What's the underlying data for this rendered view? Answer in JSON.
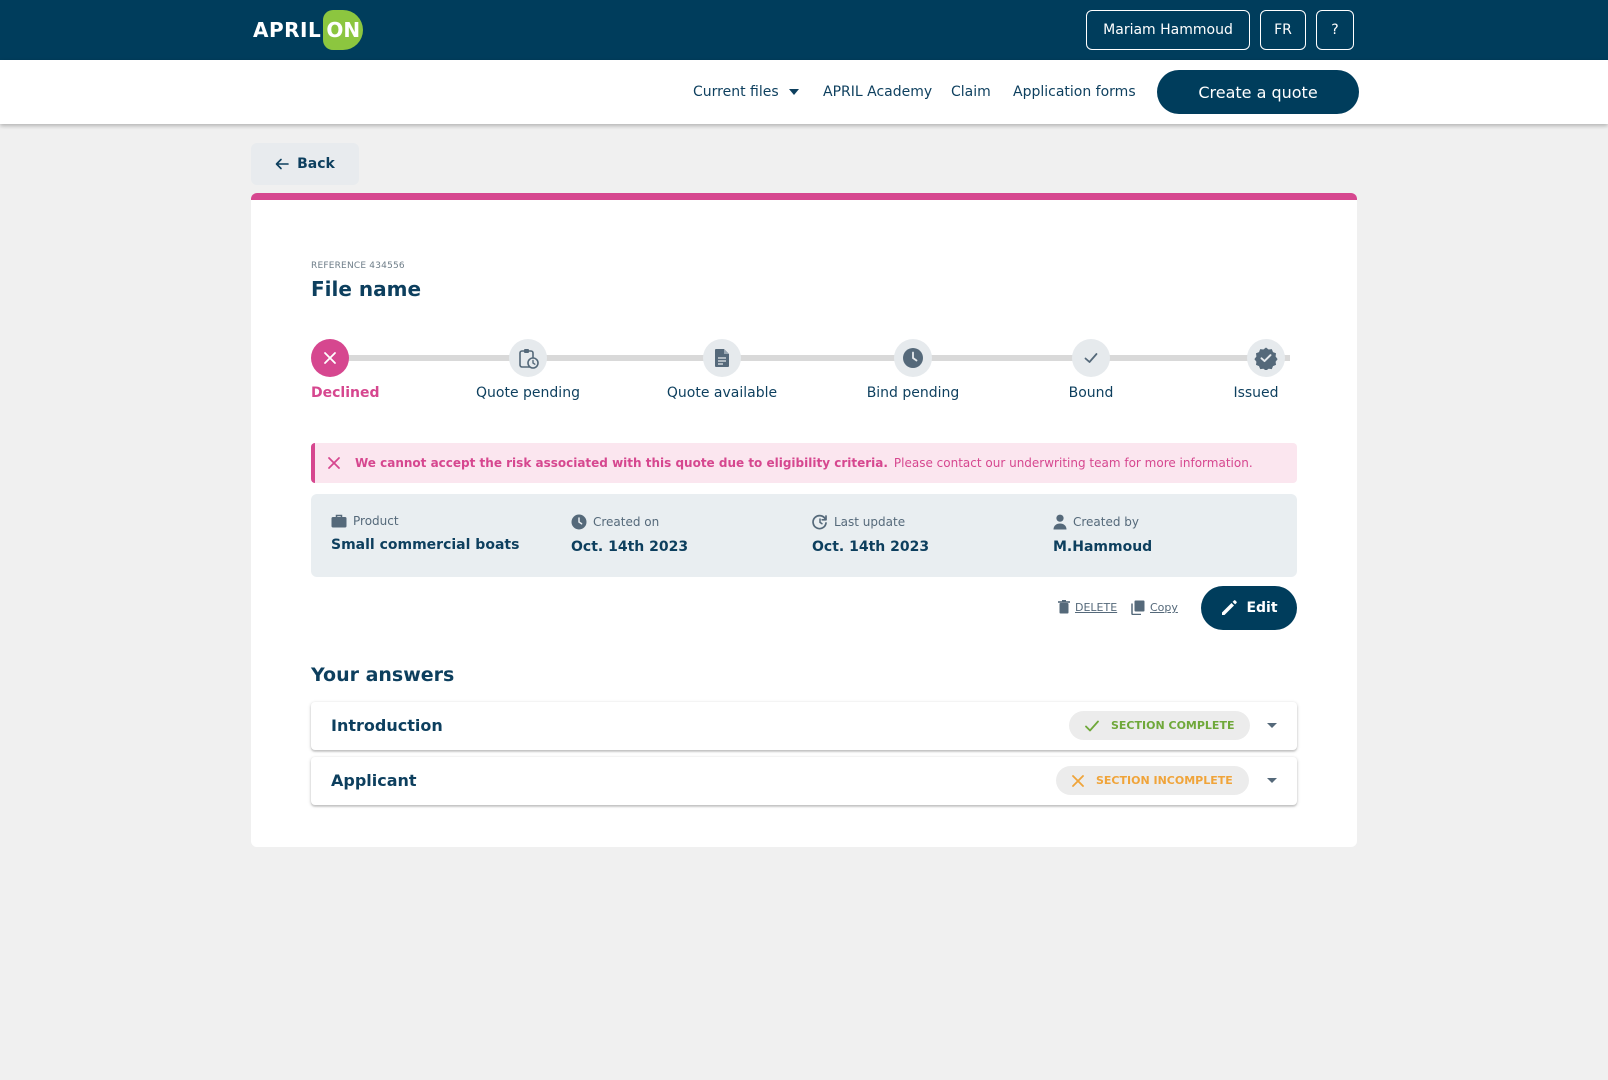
{
  "header": {
    "logo_text": "APRIL",
    "logo_badge": "ON",
    "user_button": "Mariam Hammoud",
    "lang_button": "FR",
    "help_button": "?"
  },
  "nav": {
    "current_files": "Current files",
    "academy": "APRIL Academy",
    "claim": "Claim",
    "application_forms": "Application forms",
    "create_quote": "Create a quote"
  },
  "back_label": "Back",
  "file": {
    "reference": "REFERENCE 434556",
    "name": "File name"
  },
  "steps": [
    {
      "label": "Declined",
      "icon": "close-icon",
      "state": "active"
    },
    {
      "label": "Quote pending",
      "icon": "clipboard-clock-icon",
      "state": "inactive"
    },
    {
      "label": "Quote available",
      "icon": "document-icon",
      "state": "inactive"
    },
    {
      "label": "Bind pending",
      "icon": "clock-icon",
      "state": "inactive"
    },
    {
      "label": "Bound",
      "icon": "check-icon",
      "state": "inactive"
    },
    {
      "label": "Issued",
      "icon": "verified-badge-icon",
      "state": "inactive"
    }
  ],
  "alert": {
    "bold": "We cannot accept the risk associated with this quote due to eligibility criteria.",
    "text": "Please contact our underwriting team for more information."
  },
  "info": {
    "product_label": "Product",
    "product_value": "Small commercial boats",
    "created_on_label": "Created on",
    "created_on_value": "Oct. 14th 2023",
    "last_update_label": "Last update",
    "last_update_value": "Oct. 14th 2023",
    "created_by_label": "Created by",
    "created_by_value": "M.Hammoud"
  },
  "actions": {
    "delete": "DELETE",
    "copy": "Copy",
    "edit": "Edit"
  },
  "answers": {
    "title": "Your answers",
    "sections": [
      {
        "name": "Introduction",
        "status": "SECTION COMPLETE"
      },
      {
        "name": "Applicant",
        "status": "SECTION INCOMPLETE"
      }
    ]
  },
  "colors": {
    "primary": "#003d5c",
    "accent_pink": "#d6478f",
    "logo_green": "#8cc63f",
    "complete_green": "#6fa83a",
    "incomplete_orange": "#f0a43a"
  }
}
